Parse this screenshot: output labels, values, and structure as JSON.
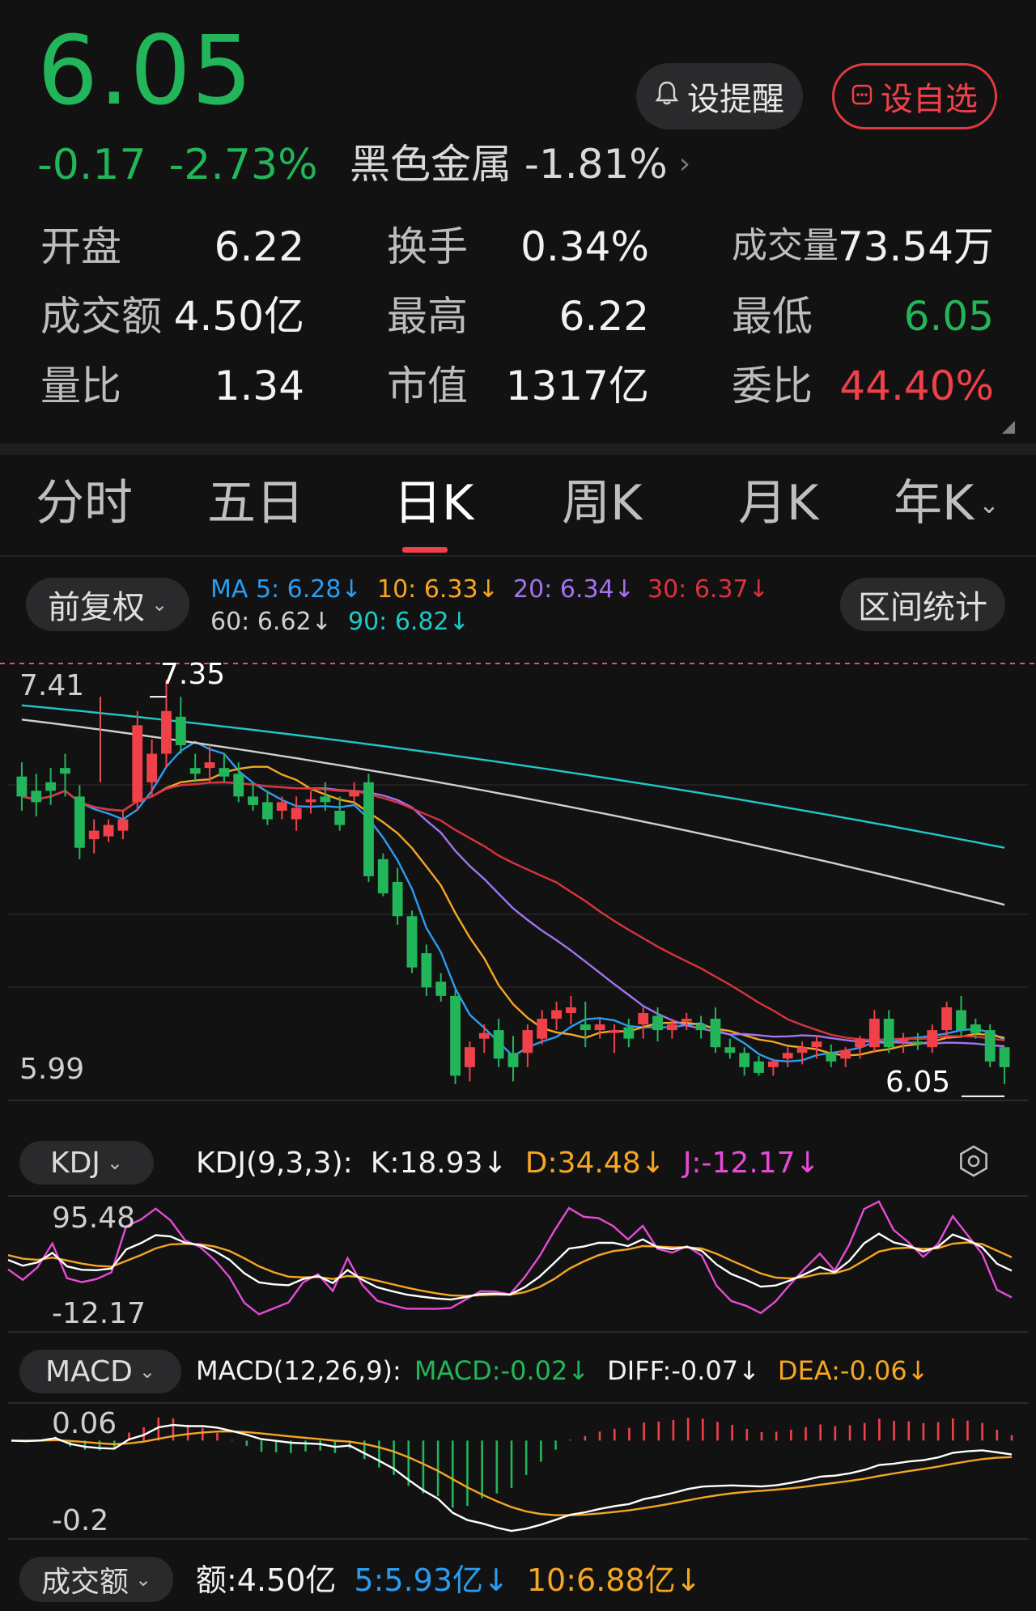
{
  "quote": {
    "price": "6.05",
    "change": "-0.17",
    "change_pct": "-2.73%",
    "sector_name": "黑色金属",
    "sector_pct": "-1.81%",
    "sector_chevron": "›"
  },
  "buttons": {
    "remind": "设提醒",
    "watch": "设自选"
  },
  "stats": [
    {
      "label": "开盘",
      "value": "6.22"
    },
    {
      "label": "换手",
      "value": "0.34%"
    },
    {
      "label": "成交量",
      "value": "73.54万"
    },
    {
      "label": "成交额",
      "value": "4.50亿"
    },
    {
      "label": "最高",
      "value": "6.22"
    },
    {
      "label": "最低",
      "value": "6.05"
    },
    {
      "label": "量比",
      "value": "1.34"
    },
    {
      "label": "市值",
      "value": "1317亿"
    },
    {
      "label": "委比",
      "value": "44.40%"
    }
  ],
  "tabs": [
    "分时",
    "五日",
    "日K",
    "周K",
    "月K",
    "年K"
  ],
  "active_tab": "日K",
  "kline": {
    "adjust_label": "前复权",
    "interval_label": "区间统计",
    "ma": [
      {
        "label": "MA 5: 6.28↓",
        "color": "#2b9df0"
      },
      {
        "label": "10: 6.33↓",
        "color": "#f5a623"
      },
      {
        "label": "20: 6.34↓",
        "color": "#a274f0"
      },
      {
        "label": "30: 6.37↓",
        "color": "#d8343e"
      },
      {
        "label": "60: 6.62↓",
        "color": "#d0d0d0"
      },
      {
        "label": "90: 6.82↓",
        "color": "#1fc9c6"
      }
    ],
    "axis_top": "7.41",
    "axis_bottom": "5.99",
    "high_marker": "7.35",
    "low_marker": "6.05"
  },
  "kdj": {
    "name": "KDJ",
    "params": "KDJ(9,3,3):",
    "k": "K:18.93↓",
    "d": "D:34.48↓",
    "j": "J:-12.17↓",
    "axis_top": "95.48",
    "axis_bottom": "-12.17"
  },
  "macd": {
    "name": "MACD",
    "params": "MACD(12,26,9):",
    "macd": "MACD:-0.02↓",
    "diff": "DIFF:-0.07↓",
    "dea": "DEA:-0.06↓",
    "axis_top": "0.06",
    "axis_bottom": "-0.2"
  },
  "volume": {
    "name": "成交额",
    "amount": "额:4.50亿",
    "ma5": "5:5.93亿↓",
    "ma10": "10:6.88亿↓"
  },
  "colors": {
    "up": "#f0414a",
    "down": "#22b55a",
    "bg": "#121212"
  },
  "chart_data": {
    "type": "candlestick",
    "candles_ohlc": [
      [
        7.07,
        7.12,
        6.95,
        7.0
      ],
      [
        7.02,
        7.08,
        6.93,
        6.98
      ],
      [
        7.05,
        7.1,
        6.97,
        7.02
      ],
      [
        7.1,
        7.15,
        7.0,
        7.08
      ],
      [
        7.0,
        7.04,
        6.78,
        6.82
      ],
      [
        6.85,
        6.92,
        6.8,
        6.88
      ],
      [
        6.86,
        6.92,
        6.84,
        6.9
      ],
      [
        6.88,
        6.95,
        6.85,
        6.92
      ],
      [
        6.98,
        7.3,
        6.95,
        7.25
      ],
      [
        7.05,
        7.2,
        7.0,
        7.15
      ],
      [
        7.15,
        7.41,
        7.1,
        7.3
      ],
      [
        7.28,
        7.35,
        7.15,
        7.18
      ],
      [
        7.1,
        7.15,
        7.05,
        7.08
      ],
      [
        7.1,
        7.18,
        7.05,
        7.12
      ],
      [
        7.1,
        7.15,
        7.05,
        7.07
      ],
      [
        7.08,
        7.12,
        6.98,
        7.0
      ],
      [
        7.0,
        7.05,
        6.95,
        6.97
      ],
      [
        6.98,
        7.02,
        6.9,
        6.92
      ],
      [
        6.95,
        7.0,
        6.92,
        6.98
      ],
      [
        6.92,
        7.0,
        6.88,
        6.96
      ],
      [
        6.98,
        7.02,
        6.94,
        6.99
      ],
      [
        7.0,
        7.05,
        6.95,
        6.98
      ],
      [
        6.95,
        7.0,
        6.88,
        6.9
      ],
      [
        7.0,
        7.05,
        6.98,
        7.02
      ],
      [
        7.05,
        7.08,
        6.7,
        6.72
      ],
      [
        6.78,
        6.8,
        6.65,
        6.66
      ],
      [
        6.7,
        6.75,
        6.55,
        6.58
      ],
      [
        6.58,
        6.6,
        6.38,
        6.4
      ],
      [
        6.45,
        6.48,
        6.3,
        6.33
      ],
      [
        6.35,
        6.38,
        6.28,
        6.3
      ],
      [
        6.3,
        6.32,
        5.99,
        6.02
      ],
      [
        6.05,
        6.14,
        6.0,
        6.12
      ],
      [
        6.15,
        6.2,
        6.1,
        6.17
      ],
      [
        6.18,
        6.22,
        6.05,
        6.08
      ],
      [
        6.1,
        6.16,
        6.0,
        6.05
      ],
      [
        6.1,
        6.2,
        6.05,
        6.18
      ],
      [
        6.15,
        6.25,
        6.13,
        6.22
      ],
      [
        6.22,
        6.28,
        6.18,
        6.25
      ],
      [
        6.24,
        6.3,
        6.2,
        6.26
      ],
      [
        6.2,
        6.28,
        6.12,
        6.18
      ],
      [
        6.18,
        6.22,
        6.15,
        6.2
      ],
      [
        6.17,
        6.2,
        6.1,
        6.18
      ],
      [
        6.19,
        6.22,
        6.12,
        6.15
      ],
      [
        6.2,
        6.26,
        6.15,
        6.24
      ],
      [
        6.23,
        6.26,
        6.14,
        6.18
      ],
      [
        6.18,
        6.22,
        6.15,
        6.2
      ],
      [
        6.21,
        6.24,
        6.18,
        6.22
      ],
      [
        6.2,
        6.23,
        6.15,
        6.18
      ],
      [
        6.22,
        6.26,
        6.1,
        6.12
      ],
      [
        6.12,
        6.15,
        6.08,
        6.1
      ],
      [
        6.1,
        6.12,
        6.02,
        6.05
      ],
      [
        6.07,
        6.09,
        6.02,
        6.03
      ],
      [
        6.05,
        6.08,
        6.02,
        6.07
      ],
      [
        6.08,
        6.12,
        6.05,
        6.1
      ],
      [
        6.1,
        6.14,
        6.06,
        6.12
      ],
      [
        6.12,
        6.16,
        6.08,
        6.14
      ],
      [
        6.1,
        6.13,
        6.05,
        6.07
      ],
      [
        6.08,
        6.12,
        6.05,
        6.11
      ],
      [
        6.12,
        6.16,
        6.08,
        6.15
      ],
      [
        6.12,
        6.25,
        6.1,
        6.22
      ],
      [
        6.22,
        6.25,
        6.1,
        6.12
      ],
      [
        6.14,
        6.17,
        6.1,
        6.15
      ],
      [
        6.14,
        6.17,
        6.11,
        6.13
      ],
      [
        6.12,
        6.2,
        6.1,
        6.18
      ],
      [
        6.18,
        6.28,
        6.15,
        6.26
      ],
      [
        6.25,
        6.3,
        6.16,
        6.18
      ],
      [
        6.2,
        6.22,
        6.15,
        6.17
      ],
      [
        6.18,
        6.2,
        6.05,
        6.07
      ],
      [
        6.12,
        6.12,
        5.99,
        6.05
      ]
    ],
    "kdj_range": [
      -12.17,
      95.48
    ],
    "macd_range": [
      -0.2,
      0.06
    ]
  }
}
